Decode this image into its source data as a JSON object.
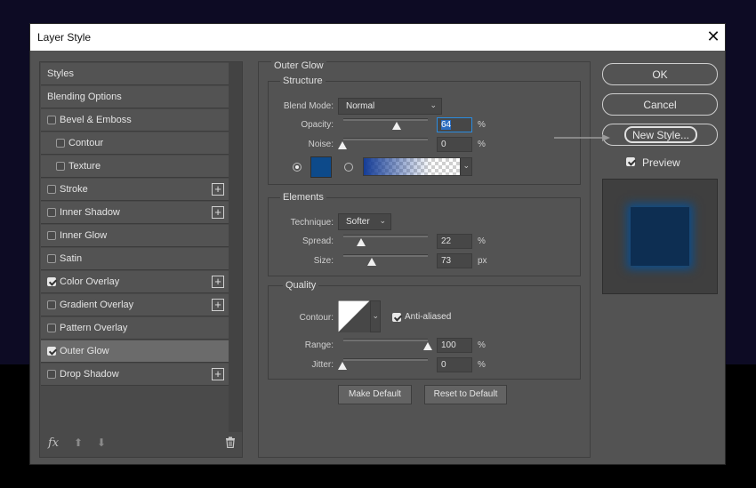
{
  "dialog": {
    "title": "Layer Style",
    "close_glyph": "✕"
  },
  "left_panel": {
    "items": [
      {
        "label": "Styles",
        "has_checkbox": false,
        "checked": false,
        "has_add": false,
        "indent": false
      },
      {
        "label": "Blending Options",
        "has_checkbox": false,
        "checked": false,
        "has_add": false,
        "indent": false
      },
      {
        "label": "Bevel & Emboss",
        "has_checkbox": true,
        "checked": false,
        "has_add": false,
        "indent": false
      },
      {
        "label": "Contour",
        "has_checkbox": true,
        "checked": false,
        "has_add": false,
        "indent": true
      },
      {
        "label": "Texture",
        "has_checkbox": true,
        "checked": false,
        "has_add": false,
        "indent": true
      },
      {
        "label": "Stroke",
        "has_checkbox": true,
        "checked": false,
        "has_add": true,
        "indent": false
      },
      {
        "label": "Inner Shadow",
        "has_checkbox": true,
        "checked": false,
        "has_add": true,
        "indent": false
      },
      {
        "label": "Inner Glow",
        "has_checkbox": true,
        "checked": false,
        "has_add": false,
        "indent": false
      },
      {
        "label": "Satin",
        "has_checkbox": true,
        "checked": false,
        "has_add": false,
        "indent": false
      },
      {
        "label": "Color Overlay",
        "has_checkbox": true,
        "checked": true,
        "has_add": true,
        "indent": false
      },
      {
        "label": "Gradient Overlay",
        "has_checkbox": true,
        "checked": false,
        "has_add": true,
        "indent": false
      },
      {
        "label": "Pattern Overlay",
        "has_checkbox": true,
        "checked": false,
        "has_add": false,
        "indent": false
      },
      {
        "label": "Outer Glow",
        "has_checkbox": true,
        "checked": true,
        "has_add": false,
        "indent": false,
        "selected": true
      },
      {
        "label": "Drop Shadow",
        "has_checkbox": true,
        "checked": false,
        "has_add": true,
        "indent": false
      }
    ],
    "fx_label": "fx",
    "up_glyph": "⬆",
    "down_glyph": "⬇"
  },
  "outer_glow": {
    "title": "Outer Glow",
    "structure": {
      "title": "Structure",
      "blend_mode_label": "Blend Mode:",
      "blend_mode_value": "Normal",
      "opacity_label": "Opacity:",
      "opacity_value": "64",
      "opacity_unit": "%",
      "noise_label": "Noise:",
      "noise_value": "0",
      "noise_unit": "%",
      "glow_color": "#0d4a8a",
      "color_mode": "solid"
    },
    "elements": {
      "title": "Elements",
      "technique_label": "Technique:",
      "technique_value": "Softer",
      "spread_label": "Spread:",
      "spread_value": "22",
      "spread_unit": "%",
      "size_label": "Size:",
      "size_value": "73",
      "size_unit": "px"
    },
    "quality": {
      "title": "Quality",
      "contour_label": "Contour:",
      "anti_aliased_label": "Anti-aliased",
      "anti_aliased_checked": true,
      "range_label": "Range:",
      "range_value": "100",
      "range_unit": "%",
      "jitter_label": "Jitter:",
      "jitter_value": "0",
      "jitter_unit": "%"
    },
    "make_default_label": "Make Default",
    "reset_default_label": "Reset to Default"
  },
  "right_panel": {
    "ok_label": "OK",
    "cancel_label": "Cancel",
    "new_style_label": "New Style...",
    "preview_label": "Preview",
    "preview_checked": true
  }
}
